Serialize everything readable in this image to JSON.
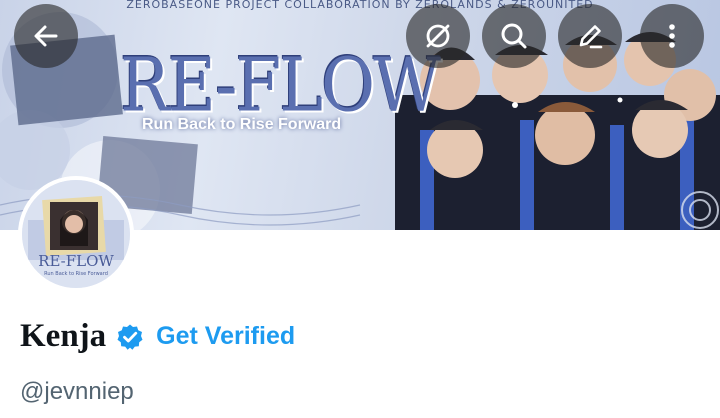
{
  "banner": {
    "top_text": "ZEROBASEONE PROJECT COLLABORATION BY ZEROLANDS & ZEROUNITED",
    "title": "RE-FLOW",
    "subtitle": "Run Back to Rise Forward"
  },
  "header_buttons": [
    {
      "name": "back-arrow-icon"
    },
    {
      "name": "no-visibility-icon"
    },
    {
      "name": "search-icon"
    },
    {
      "name": "edit-pen-icon"
    },
    {
      "name": "more-vertical-icon"
    }
  ],
  "avatar": {
    "logo_text": "RE-FLOW",
    "logo_subtext": "Run Back to Rise Forward"
  },
  "profile": {
    "display_name": "Kenja",
    "get_verified_label": "Get Verified",
    "handle": "@jevnniep"
  },
  "colors": {
    "accent": "#1d9bf0",
    "text_primary": "#0f1419",
    "text_secondary": "#536471"
  }
}
